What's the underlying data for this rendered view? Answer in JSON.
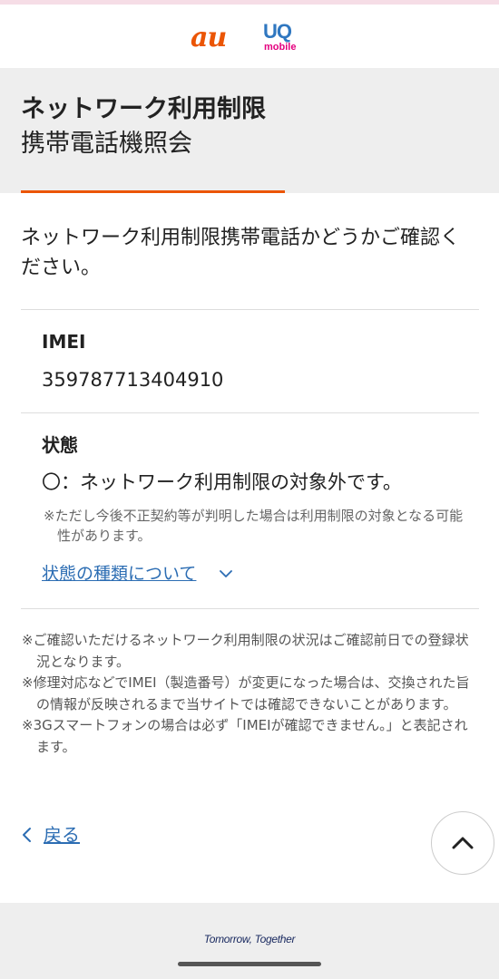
{
  "brand": {
    "au_logo": "au",
    "uq_logo": "UQ",
    "uq_logo_sub": "mobile",
    "au_color": "#eb5505",
    "uq_color": "#2f77c0",
    "uq_sub_color": "#e4007f"
  },
  "title": {
    "line1": "ネットワーク利用制限",
    "line2": "携帯電話機照会"
  },
  "intro": "ネットワーク利用制限携帯電話かどうかご確認ください。",
  "imei": {
    "label": "IMEI",
    "value": "359787713404910"
  },
  "status": {
    "label": "状態",
    "text": "〇：ネットワーク利用制限の対象外です。",
    "note": "※ただし今後不正契約等が判明した場合は利用制限の対象となる可能性があります。",
    "link": "状態の種類について",
    "link_icon": "chevron-down-icon"
  },
  "notes": [
    "※ご確認いただけるネットワーク利用制限の状況はご確認前日での登録状況となります。",
    "※修理対応などでIMEI（製造番号）が変更になった場合は、交換された旨の情報が反映されるまで当サイトでは確認できないことがあります。",
    "※3Gスマートフォンの場合は必ず「IMEIが確認できません。」と表記されます。"
  ],
  "back": {
    "label": "戻る",
    "icon": "chevron-left-icon"
  },
  "scroll_top_icon": "chevron-up-icon",
  "footer": {
    "tagline": "Tomorrow, Together"
  },
  "colors": {
    "accent": "#eb5505",
    "link": "#2c6db3"
  }
}
